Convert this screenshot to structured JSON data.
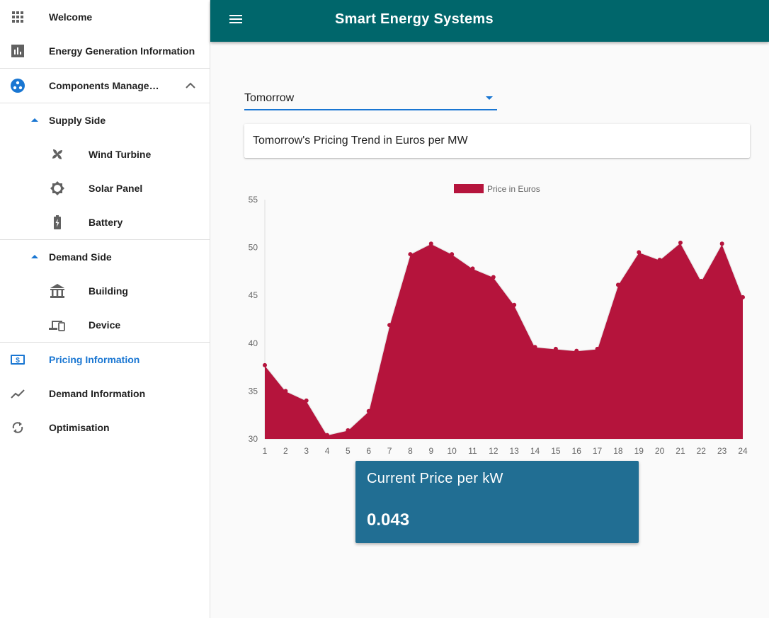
{
  "sidebar": {
    "items": [
      {
        "label": "Welcome",
        "icon": "apps-grid-icon"
      },
      {
        "label": "Energy Generation Information",
        "icon": "bar-chart-icon"
      },
      {
        "label": "Components Manage…",
        "icon": "components-icon"
      },
      {
        "label": "Supply Side",
        "icon": "caret-up-icon"
      },
      {
        "label": "Wind Turbine",
        "icon": "fan-icon"
      },
      {
        "label": "Solar Panel",
        "icon": "sun-icon"
      },
      {
        "label": "Battery",
        "icon": "battery-icon"
      },
      {
        "label": "Demand Side",
        "icon": "caret-up-icon"
      },
      {
        "label": "Building",
        "icon": "building-icon"
      },
      {
        "label": "Device",
        "icon": "devices-icon"
      },
      {
        "label": "Pricing Information",
        "icon": "dollar-icon"
      },
      {
        "label": "Demand Information",
        "icon": "trending-icon"
      },
      {
        "label": "Optimisation",
        "icon": "sync-icon"
      }
    ]
  },
  "header": {
    "title": "Smart Energy Systems"
  },
  "select": {
    "value": "Tomorrow"
  },
  "card": {
    "title": "Tomorrow's Pricing Trend in Euros per MW"
  },
  "price": {
    "title": "Current Price per kW",
    "value": "0.043"
  },
  "colors": {
    "appbar": "#00666b",
    "accent": "#1976d2",
    "series": "#b5143c",
    "price_box": "#216e93"
  },
  "chart_data": {
    "type": "area",
    "categories": [
      "1",
      "2",
      "3",
      "4",
      "5",
      "6",
      "7",
      "8",
      "9",
      "10",
      "11",
      "12",
      "13",
      "14",
      "15",
      "16",
      "17",
      "18",
      "19",
      "20",
      "21",
      "22",
      "23",
      "24"
    ],
    "series": [
      {
        "name": "Price in Euros",
        "values": [
          37.7,
          35.0,
          34.0,
          30.4,
          30.9,
          32.9,
          41.9,
          49.3,
          50.4,
          49.3,
          47.8,
          46.9,
          44.0,
          39.6,
          39.4,
          39.2,
          39.4,
          46.1,
          49.5,
          48.7,
          50.5,
          46.5,
          50.4,
          44.8
        ]
      }
    ],
    "yticks": [
      30,
      35,
      40,
      45,
      50,
      55
    ],
    "ylim": [
      30,
      55
    ],
    "legend": "top-center",
    "grid": false
  }
}
